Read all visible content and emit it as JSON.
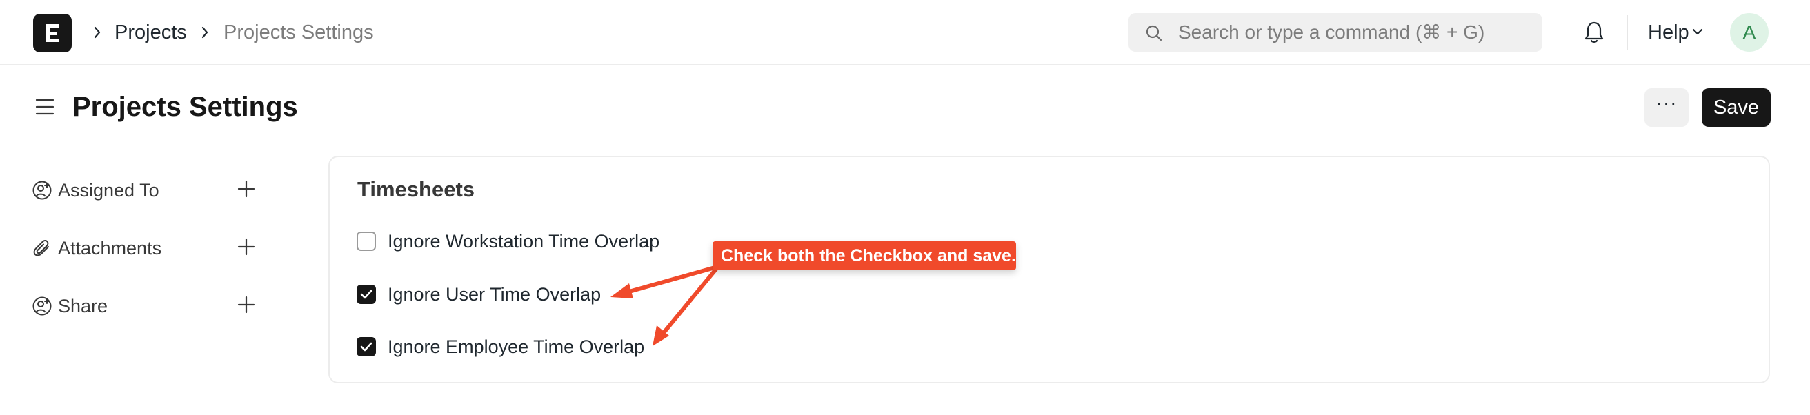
{
  "navbar": {
    "breadcrumbs": [
      "Projects",
      "Projects Settings"
    ],
    "search_placeholder": "Search or type a command (⌘ + G)",
    "help_label": "Help",
    "avatar_initial": "A"
  },
  "page": {
    "title": "Projects Settings",
    "more_label": "···",
    "save_label": "Save"
  },
  "sidebar": {
    "items": [
      {
        "label": "Assigned To",
        "icon": "user-add-icon"
      },
      {
        "label": "Attachments",
        "icon": "paperclip-icon"
      },
      {
        "label": "Share",
        "icon": "user-add-icon"
      }
    ]
  },
  "section": {
    "title": "Timesheets",
    "checkboxes": [
      {
        "label": "Ignore Workstation Time Overlap",
        "checked": false
      },
      {
        "label": "Ignore User Time Overlap",
        "checked": true
      },
      {
        "label": "Ignore Employee Time Overlap",
        "checked": true
      }
    ]
  },
  "annotation": {
    "text": "Check both the Checkbox and save.",
    "color": "#f04a2b"
  }
}
